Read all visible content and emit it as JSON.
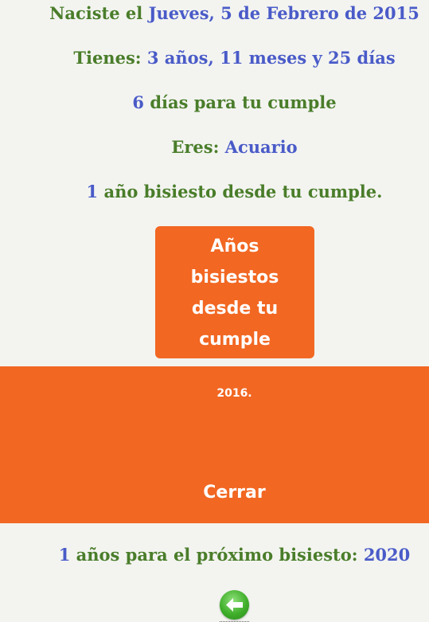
{
  "birth": {
    "prefix": "Naciste el ",
    "date": "Jueves, 5 de Febrero de 2015"
  },
  "age": {
    "prefix": "Tienes: ",
    "value": "3 años, 11 meses y 25 días"
  },
  "birthday": {
    "days": "6",
    "suffix": " días para tu cumple"
  },
  "zodiac": {
    "prefix": "Eres: ",
    "sign": "Acuario"
  },
  "leap_since": {
    "count": "1",
    "suffix": " año bisiesto desde tu cumple."
  },
  "leap_button": {
    "lines": [
      "Años",
      "bisiestos",
      "desde tu",
      "cumple"
    ]
  },
  "leap_panel": {
    "years": "2016.",
    "close_label": "Cerrar"
  },
  "next_leap": {
    "count": "1",
    "middle": " años para el próximo bisiesto: ",
    "year": "2020"
  },
  "colors": {
    "green_text": "#4a7d2a",
    "blue_text": "#4a5bc8",
    "orange": "#f26722",
    "background": "#f3f4f0"
  },
  "icons": {
    "back": "back-arrow-icon"
  }
}
